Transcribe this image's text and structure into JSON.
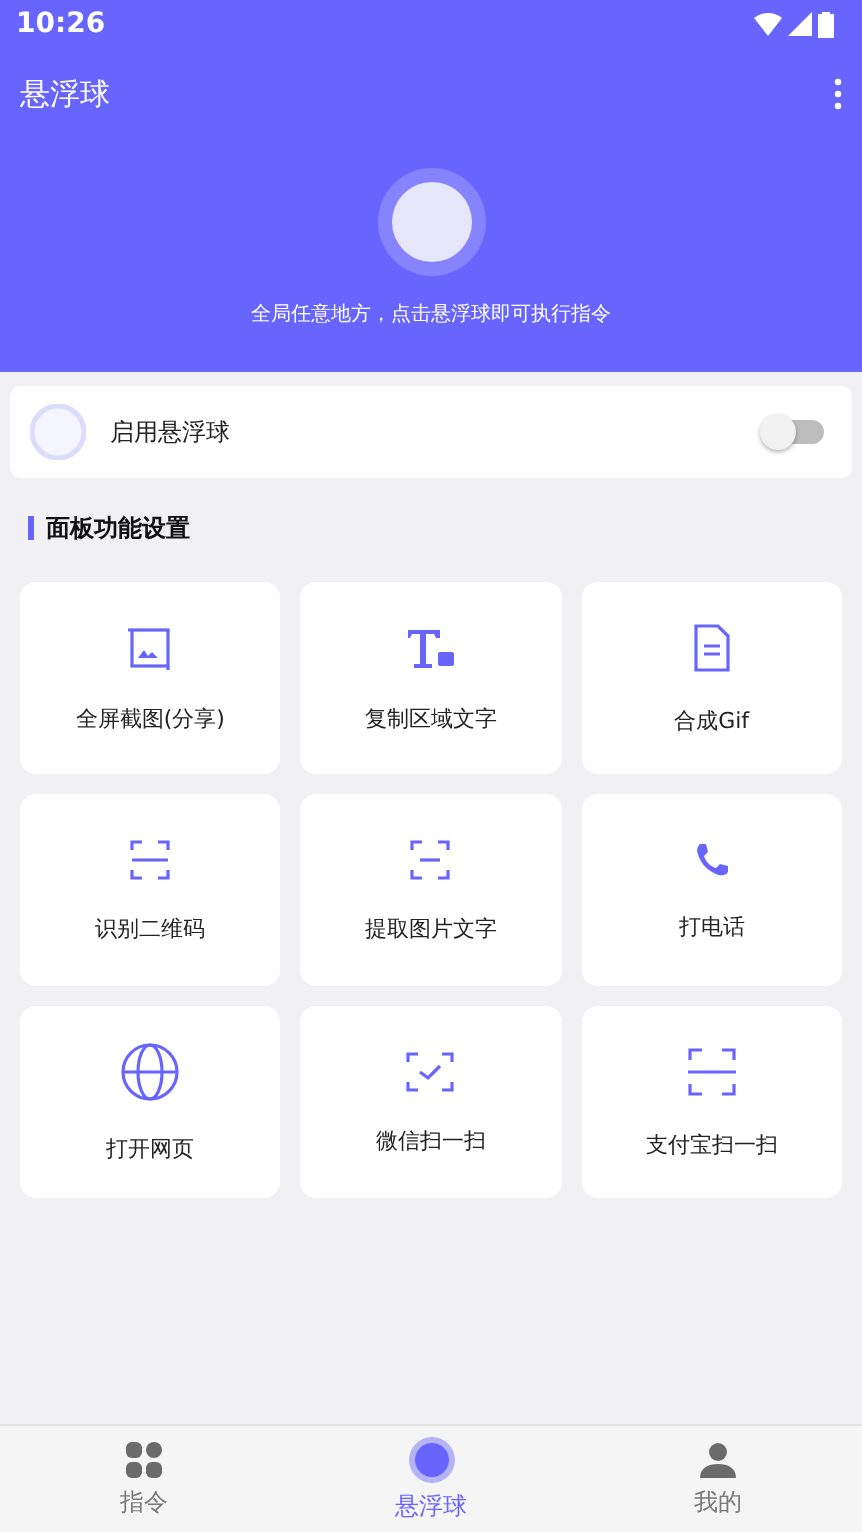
{
  "status_bar": {
    "time": "10:26"
  },
  "app_bar": {
    "title": "悬浮球"
  },
  "hero": {
    "hint": "全局任意地方，点击悬浮球即可执行指令"
  },
  "enable_row": {
    "label": "启用悬浮球",
    "on": false
  },
  "section": {
    "title": "面板功能设置"
  },
  "tiles": [
    {
      "kind": "screenshot",
      "label": "全屏截图(分享)"
    },
    {
      "kind": "text",
      "label": "复制区域文字"
    },
    {
      "kind": "gif",
      "label": "合成Gif"
    },
    {
      "kind": "qr",
      "label": "识别二维码"
    },
    {
      "kind": "ocr",
      "label": "提取图片文字"
    },
    {
      "kind": "phone",
      "label": "打电话"
    },
    {
      "kind": "web",
      "label": "打开网页"
    },
    {
      "kind": "check",
      "label": "微信扫一扫"
    },
    {
      "kind": "scan",
      "label": "支付宝扫一扫"
    }
  ],
  "bottom_nav": [
    {
      "kind": "grid",
      "label": "指令",
      "selected": false
    },
    {
      "kind": "ball",
      "label": "悬浮球",
      "selected": true
    },
    {
      "kind": "person",
      "label": "我的",
      "selected": false
    }
  ]
}
